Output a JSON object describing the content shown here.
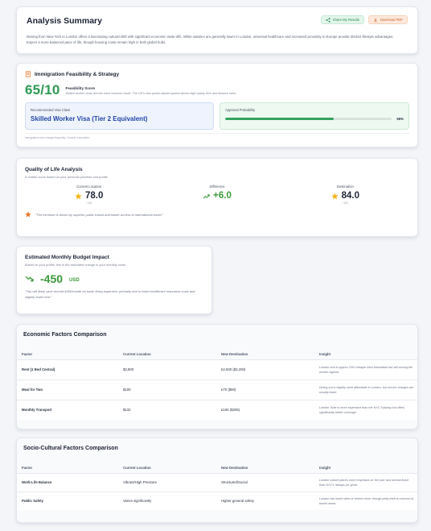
{
  "summary": {
    "title": "Analysis Summary",
    "share_label": "Share My Results",
    "pdf_label": "Download PDF",
    "text": "Moving from New York to London offers a fascinating cultural shift with significant economic trade-offs. While salaries are generally lower in London, universal healthcare and increased proximity to Europe provide distinct lifestyle advantages. Expect a more balanced pace of life, though housing costs remain high in both global hubs."
  },
  "immigration": {
    "title": "Immigration Feasibility & Strategy",
    "score": "65/10",
    "score_label": "Feasibility Score",
    "score_desc": "Skilled worker visas are the most common route. The UK's new points-based system favors high-salary tech and finance roles.",
    "visa_label": "Recommended Visa Class",
    "visa_value": "Skilled Worker Visa (Tier 2 Equivalent)",
    "prob_label": "Approval Probability",
    "prob_value": "65%",
    "prob_fraction": 0.65,
    "disclaimer": "Immigration rules change frequently. Consult a specialist."
  },
  "quality": {
    "title": "Quality of Life Analysis",
    "subtitle": "A holistic score based on your personal priorities and profile.",
    "current_label": "Current Location",
    "current_value": "78.0",
    "current_unit": "/ 100",
    "diff_label": "Difference",
    "diff_value": "+6.0",
    "dest_label": "Destination",
    "dest_value": "84.0",
    "dest_unit": "/ 100",
    "note": "\"The increase is driven by superior public transit and easier access to international travel.\""
  },
  "budget": {
    "title": "Estimated Monthly Budget Impact",
    "subtitle": "Based on your profile, this is the estimated change in your monthly costs.",
    "amount": "-450",
    "currency": "USD",
    "note": "\"You will likely save around $450/month on basic living expenses, primarily due to lower healthcare insurance costs and slightly lower rent.\""
  },
  "economic": {
    "title": "Economic Factors Comparison",
    "headers": [
      "Factor",
      "Current Location",
      "New Destination",
      "Insight"
    ],
    "rows": [
      [
        "Rent (1 Bed Central)",
        "$3,800",
        "£2,500 ($3,200)",
        "London rent is approx 15% cheaper than Manhattan but still among the world's highest."
      ],
      [
        "Meal for Two",
        "$100",
        "£70 ($90)",
        "Dining out is slightly more affordable in London, but service charges are usually lower."
      ],
      [
        "Monthly Transport",
        "$132",
        "£160 ($205)",
        "London Tube is more expensive than the NYC Subway but offers significantly better coverage."
      ]
    ]
  },
  "socio": {
    "title": "Socio-Cultural Factors Comparison",
    "headers": [
      "Factor",
      "Current Location",
      "New Destination",
      "Insight"
    ],
    "rows": [
      [
        "Work-Life Balance",
        "Vibrant/High Pressure",
        "Structured/Social",
        "London culture places more emphasis on 'the pub' and annual leave than NYC's 'always-on' grind."
      ],
      [
        "Public Safety",
        "Varies significantly",
        "Higher general safety",
        "London has lower rates of violent crime, though petty theft is common in tourist areas."
      ]
    ]
  },
  "colors": {
    "green": "#3b9a3b",
    "blue": "#2346a6",
    "orange": "#e8772e"
  }
}
